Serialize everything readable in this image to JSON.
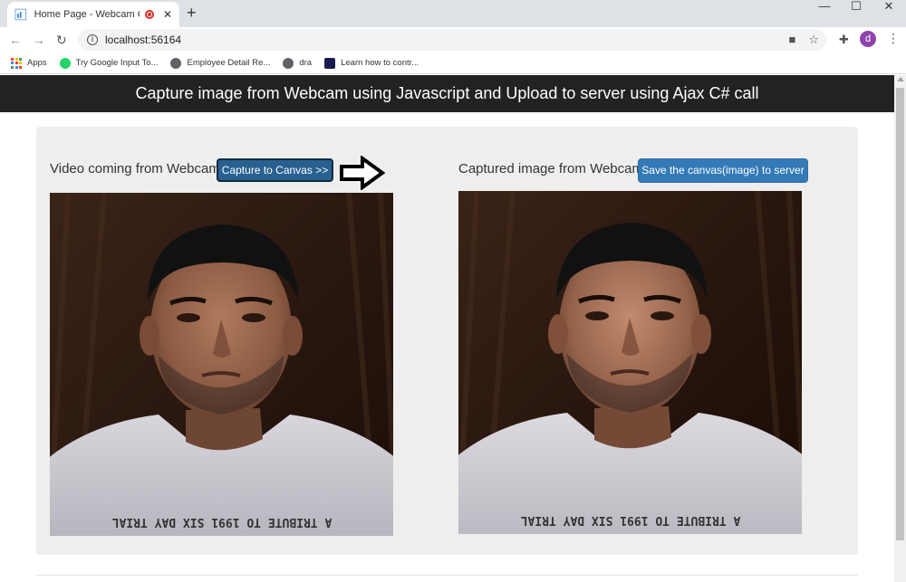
{
  "browser": {
    "tab_title": "Home Page - Webcam Captu",
    "url": "localhost:56164",
    "avatar_letter": "d",
    "bookmarks": [
      {
        "label": "Apps"
      },
      {
        "label": "Try Google Input To..."
      },
      {
        "label": "Employee Detail Re..."
      },
      {
        "label": "dra"
      },
      {
        "label": "Learn how to contr..."
      }
    ]
  },
  "page": {
    "header": "Capture image from Webcam using Javascript and Upload to server using Ajax C# call",
    "left_label": "Video coming from Webcam",
    "capture_button": "Capture to Canvas >>",
    "right_label": "Captured image from Webcam",
    "save_button": "Save the canvas(image) to server",
    "shirt_text": "A TRIBUTE TO 1991 SIX DAY TRIAL"
  },
  "colors": {
    "header_bg": "#222222",
    "primary_button": "#337ab7",
    "active_button": "#286090",
    "well_bg": "#eeeeee"
  }
}
